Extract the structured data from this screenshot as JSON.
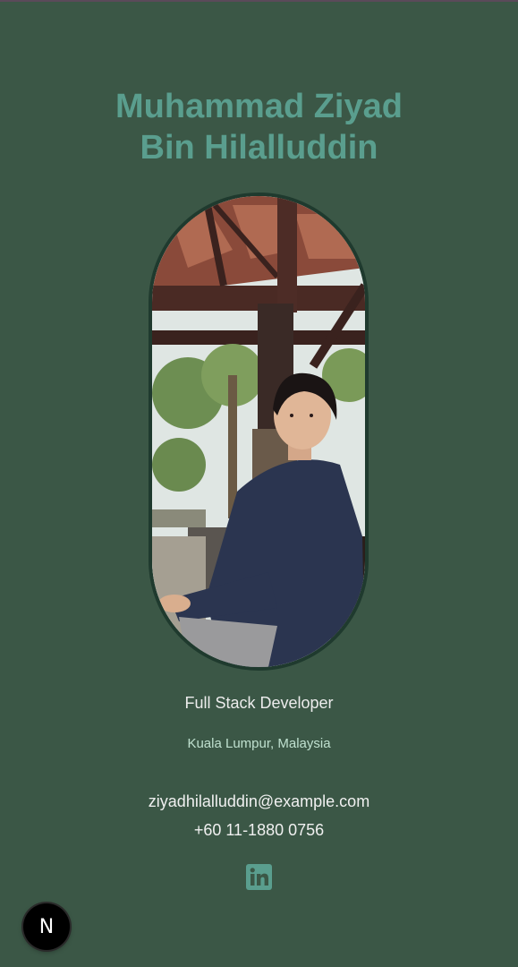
{
  "profile": {
    "name_line1": "Muhammad Ziyad",
    "name_line2": "Bin Hilalluddin",
    "photo_alt": "Portrait of Muhammad Ziyad",
    "role": "Full Stack Developer",
    "location": "Kuala Lumpur, Malaysia"
  },
  "contact": {
    "email": "ziyadhilalluddin@example.com",
    "phone": "+60 11-1880 0756"
  },
  "social": {
    "linkedin_icon": "linkedin-icon"
  },
  "dev_badge": {
    "letter": "N",
    "icon": "nextjs-icon"
  },
  "colors": {
    "background": "#3b5746",
    "name": "#5a9e8e",
    "accent": "#5a9e8e",
    "text": "#f0f0f0"
  }
}
